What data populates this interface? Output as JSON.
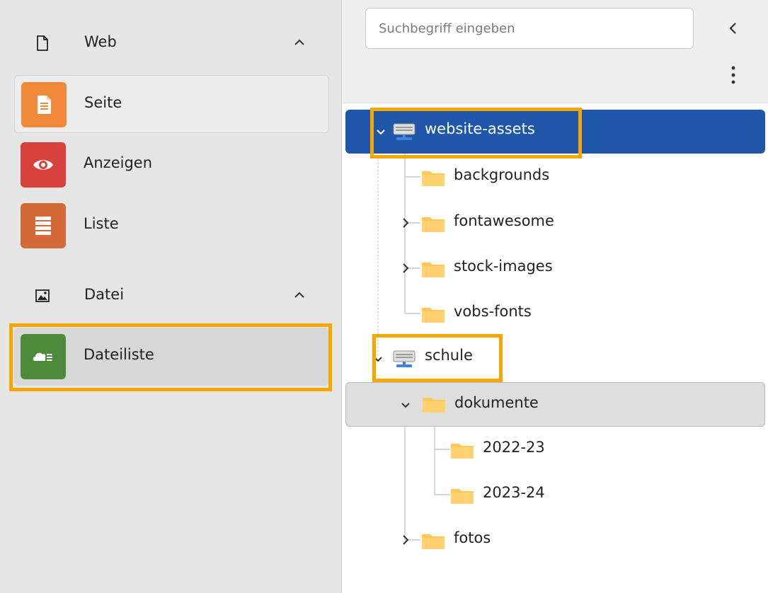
{
  "module_menu": {
    "groups": [
      {
        "label": "Web",
        "icon": "page-outline-icon",
        "items": [
          {
            "label": "Seite",
            "icon": "document-icon",
            "color": "#f1893a"
          },
          {
            "label": "Anzeigen",
            "icon": "eye-icon",
            "color": "#d9413d"
          },
          {
            "label": "Liste",
            "icon": "list-icon",
            "color": "#d4693a"
          }
        ]
      },
      {
        "label": "Datei",
        "icon": "image-icon",
        "items": [
          {
            "label": "Dateiliste",
            "icon": "cloud-files-icon",
            "color": "#4e8a3c"
          }
        ]
      }
    ]
  },
  "file_tree": {
    "search": {
      "placeholder": "Suchbegriff eingeben"
    },
    "nodes": [
      {
        "label": "website-assets",
        "type": "storage",
        "state": "selected"
      },
      {
        "label": "backgrounds",
        "type": "folder"
      },
      {
        "label": "fontawesome",
        "type": "folder",
        "expandable": true
      },
      {
        "label": "stock-images",
        "type": "folder",
        "expandable": true
      },
      {
        "label": "vobs-fonts",
        "type": "folder"
      },
      {
        "label": "schule",
        "type": "storage"
      },
      {
        "label": "dokumente",
        "type": "folder",
        "state": "focused",
        "expanded": true
      },
      {
        "label": "2022-23",
        "type": "folder"
      },
      {
        "label": "2023-24",
        "type": "folder"
      },
      {
        "label": "fotos",
        "type": "folder",
        "expandable": true
      }
    ]
  },
  "colors": {
    "highlight": "#f7a800",
    "selected": "#2057a8",
    "folder": "#ffc857"
  }
}
